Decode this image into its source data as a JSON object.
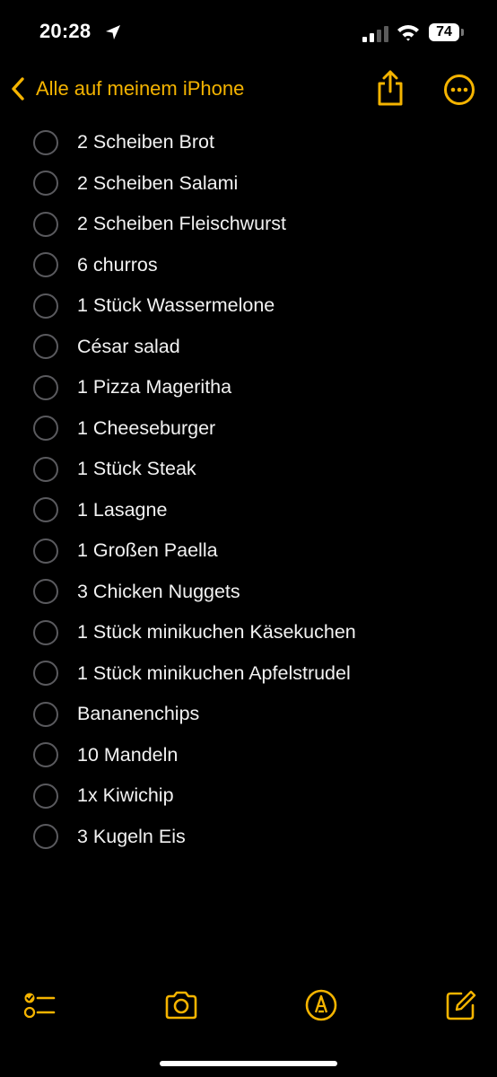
{
  "status_bar": {
    "time": "20:28",
    "battery": "74"
  },
  "nav": {
    "back_label": "Alle auf meinem iPhone"
  },
  "checklist": {
    "items": [
      "2 Scheiben Brot",
      "2 Scheiben Salami",
      "2 Scheiben Fleischwurst",
      "6 churros",
      "1 Stück Wassermelone",
      "César salad",
      "1 Pizza Mageritha",
      "1 Cheeseburger",
      "1 Stück Steak",
      "1 Lasagne",
      "1 Großen Paella",
      "3 Chicken Nuggets",
      "1 Stück minikuchen Käsekuchen",
      "1 Stück minikuchen Apfelstrudel",
      "Bananenchips",
      "10 Mandeln",
      "1x Kiwichip",
      "3 Kugeln Eis"
    ]
  },
  "icons": {
    "location": "location-arrow-icon",
    "signal": "cellular-signal-icon",
    "wifi": "wifi-icon",
    "back": "chevron-left-icon",
    "share": "share-icon",
    "more": "more-ellipsis-icon",
    "checklist": "checklist-icon",
    "camera": "camera-icon",
    "markup": "markup-pen-icon",
    "compose": "compose-icon"
  },
  "colors": {
    "accent": "#f5b400",
    "background": "#000000",
    "text": "#f2f2f2",
    "checkbox_border": "#5a5a5e"
  }
}
